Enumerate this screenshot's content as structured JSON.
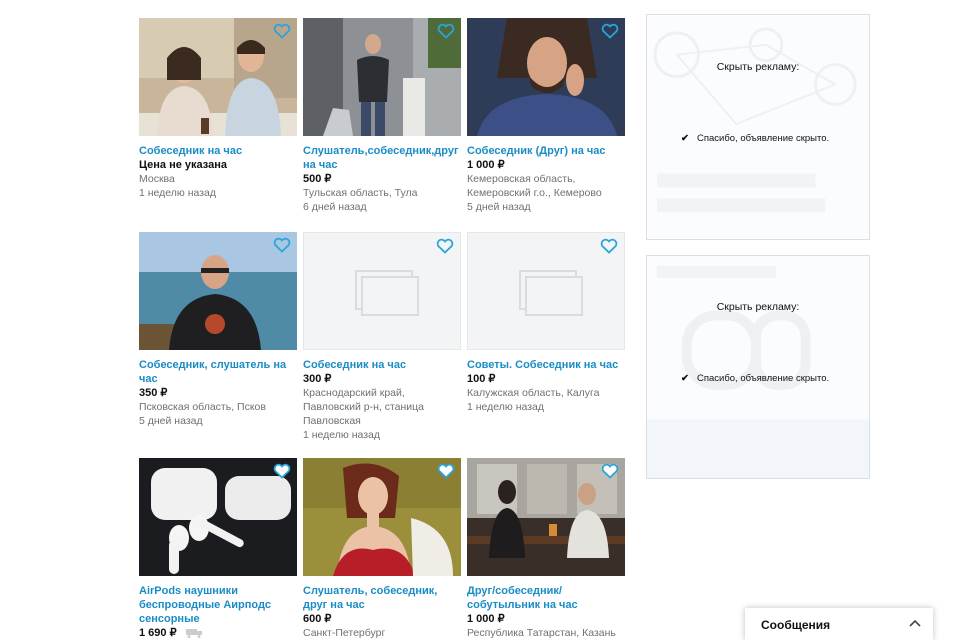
{
  "listings": [
    {
      "title": "Собеседник на час",
      "price": "Цена не указана",
      "location": "Москва",
      "date": "1 неделю назад",
      "photo": "couple-cafe-photo"
    },
    {
      "title": "Слушатель,собеседник,друг на час",
      "price": "500 ₽",
      "location": "Тульская область, Тула",
      "date": "6 дней назад",
      "photo": "man-statue-photo"
    },
    {
      "title": "Собеседник (Друг) на час",
      "price": "1 000 ₽",
      "location": "Кемеровская область, Кемеровский г.о., Кемерово",
      "date": "5 дней назад",
      "photo": "man-phone-photo"
    },
    {
      "title": "Собеседник, слушатель на час",
      "price": "350 ₽",
      "location": "Псковская область, Псков",
      "date": "5 дней назад",
      "photo": "man-sea-photo"
    },
    {
      "title": "Собеседник на час",
      "price": "300 ₽",
      "location": "Краснодарский край, Павловский р-н, станица Павловская",
      "date": "1 неделю назад",
      "photo": "no-photo-placeholder"
    },
    {
      "title": "Советы. Собеседник на час",
      "price": "100 ₽",
      "location": "Калужская область, Калуга",
      "date": "1 неделю назад",
      "photo": "no-photo-placeholder"
    },
    {
      "title": "AirPods наушники беспроводные Аирподс сенсорные",
      "price": "1 690 ₽",
      "location": "",
      "date": "",
      "photo": "airpods-photo"
    },
    {
      "title": "Слушатель, собеседник, друг на час",
      "price": "600 ₽",
      "location": "Санкт-Петербург",
      "date": "",
      "photo": "woman-painting-photo"
    },
    {
      "title": "Друг/собеседник/ собутыльник на час",
      "price": "1 000 ₽",
      "location": "Республика Татарстан, Казань",
      "date": "",
      "photo": "bar-couple-photo"
    }
  ],
  "ads": [
    {
      "hide_label": "Скрыть рекламу:",
      "hidden_text": "Спасибо, объявление скрыто."
    },
    {
      "hide_label": "Скрыть рекламу:",
      "hidden_text": "Спасибо, объявление скрыто."
    }
  ],
  "messages": {
    "label": "Сообщения"
  },
  "colors": {
    "link": "#1a8cc6",
    "heart": "#2aa5d8"
  }
}
